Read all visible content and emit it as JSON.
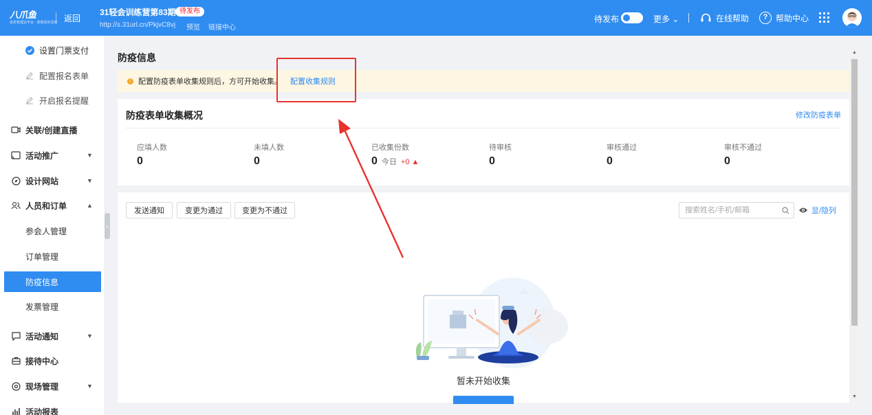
{
  "brand": {
    "logo_text": "八爪鱼",
    "logo_sub": "会务管理云平台 · 高效举办活动",
    "accent": "#2f8cf0"
  },
  "header": {
    "back_label": "返回",
    "event_title": "31轻会训练营第83期",
    "status_badge": "待发布",
    "event_url": "http://s.31url.cn/PkjvC8vj",
    "preview_label": "预览",
    "link_center_label": "链接中心",
    "publish_label": "待发布",
    "more_label": "更多 ⌄",
    "online_help_label": "在线帮助",
    "help_center_label": "帮助中心",
    "help_icon_glyph": "?"
  },
  "sidebar": {
    "items": [
      {
        "label": "设置门票支付",
        "icon": "check-circle-icon"
      },
      {
        "label": "配置报名表单",
        "icon": "pencil-icon"
      },
      {
        "label": "开启报名提醒",
        "icon": "pencil-icon"
      },
      {
        "label": "关联/创建直播",
        "icon": "video-icon"
      },
      {
        "label": "活动推广",
        "icon": "cast-icon",
        "caret": "▼"
      },
      {
        "label": "设计网站",
        "icon": "compass-icon",
        "caret": "▼"
      },
      {
        "label": "人员和订单",
        "icon": "users-icon",
        "caret": "▲"
      },
      {
        "label": "参会人管理"
      },
      {
        "label": "订单管理"
      },
      {
        "label": "防疫信息",
        "active": true
      },
      {
        "label": "发票管理"
      },
      {
        "label": "活动通知",
        "icon": "message-icon",
        "caret": "▼"
      },
      {
        "label": "接待中心",
        "icon": "briefcase-icon"
      },
      {
        "label": "现场管理",
        "icon": "target-icon",
        "caret": "▼"
      },
      {
        "label": "活动报表",
        "icon": "bar-chart-icon"
      }
    ],
    "collapse_glyph": "‹"
  },
  "main": {
    "page_title": "防疫信息",
    "notice": {
      "icon_glyph": "!",
      "text": "配置防疫表单收集规则后，方可开始收集。",
      "link": "配置收集规则"
    },
    "summary": {
      "title": "防疫表单收集概况",
      "edit_link": "修改防疫表单",
      "stats": [
        {
          "label": "应填人数",
          "value": "0"
        },
        {
          "label": "未填人数",
          "value": "0"
        },
        {
          "label": "已收集份数",
          "value": "0",
          "today_label": "今日",
          "delta": "+0 ▲"
        },
        {
          "label": "待审核",
          "value": "0"
        },
        {
          "label": "审核通过",
          "value": "0"
        },
        {
          "label": "审核不通过",
          "value": "0"
        }
      ]
    },
    "list": {
      "btn_send": "发送通知",
      "btn_pass": "变更为通过",
      "btn_fail": "变更为不通过",
      "search_placeholder": "搜索姓名/手机/邮箱",
      "toggle_cols": "显/隐列",
      "empty_text": "暂未开始收集"
    }
  },
  "scrollbar": {
    "up_glyph": "▲",
    "down_glyph": "▼"
  },
  "colors": {
    "accent": "#2f8cf0",
    "warning": "#f5a623",
    "danger": "#e8322e",
    "notice_bg": "#fdf6e3"
  }
}
